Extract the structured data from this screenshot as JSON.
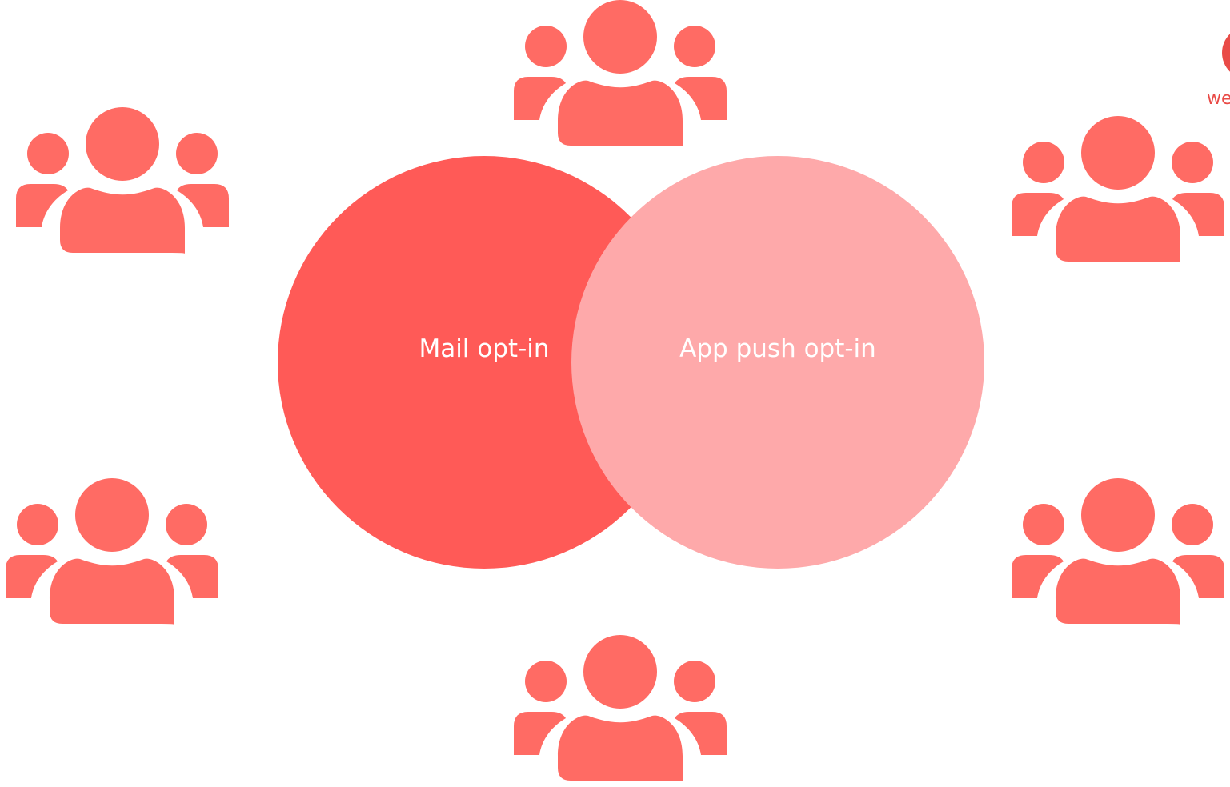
{
  "colors": {
    "icon": "#FF6B64",
    "circle_mail": "#FF5A57",
    "circle_push": "#FEA9AA",
    "label_text": "#FFFFFF",
    "logo": "#E94B47"
  },
  "venn": {
    "left_label": "Mail opt-in",
    "right_label": "App push opt-in"
  },
  "icons": [
    {
      "name": "users-group-icon-top"
    },
    {
      "name": "users-group-icon-top-left"
    },
    {
      "name": "users-group-icon-top-right"
    },
    {
      "name": "users-group-icon-bottom-left"
    },
    {
      "name": "users-group-icon-bottom-right"
    },
    {
      "name": "users-group-icon-bottom"
    }
  ],
  "logo": {
    "text": "we"
  }
}
